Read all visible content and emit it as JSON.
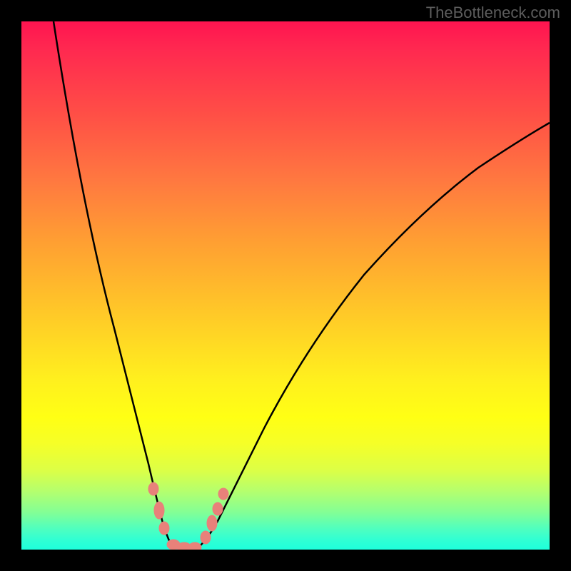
{
  "watermark": "TheBottleneck.com",
  "chart_data": {
    "type": "line",
    "title": "",
    "xlabel": "",
    "ylabel": "",
    "ylim": [
      0,
      100
    ],
    "xlim": [
      0,
      100
    ],
    "background_gradient": {
      "type": "vertical",
      "colors": [
        "#ff1450",
        "#ffa032",
        "#ffff14",
        "#32ffd2"
      ],
      "meaning": "bottleneck severity (red=high, green=low)"
    },
    "series": [
      {
        "name": "left-curve",
        "description": "descending curve from top-left to minimum",
        "x": [
          6,
          10,
          14,
          18,
          22,
          24,
          26,
          27,
          28
        ],
        "y": [
          100,
          80,
          58,
          38,
          20,
          12,
          6,
          3,
          0
        ]
      },
      {
        "name": "right-curve",
        "description": "ascending curve from minimum to top-right",
        "x": [
          33,
          35,
          38,
          42,
          48,
          56,
          66,
          78,
          92,
          100
        ],
        "y": [
          0,
          3,
          8,
          16,
          27,
          40,
          52,
          63,
          73,
          78
        ]
      },
      {
        "name": "flat-minimum",
        "description": "optimal zone at bottom",
        "x": [
          28,
          29,
          30,
          31,
          32,
          33
        ],
        "y": [
          0,
          0,
          0,
          0,
          0,
          0
        ]
      }
    ],
    "markers": {
      "description": "salmon colored data points near minimum",
      "color": "#e8817a",
      "points": [
        {
          "x": 25,
          "y": 11
        },
        {
          "x": 26.5,
          "y": 6
        },
        {
          "x": 28,
          "y": 1.5
        },
        {
          "x": 29.5,
          "y": 0.5
        },
        {
          "x": 31,
          "y": 0.5
        },
        {
          "x": 32.5,
          "y": 0.5
        },
        {
          "x": 34,
          "y": 2
        },
        {
          "x": 35.5,
          "y": 5
        },
        {
          "x": 37,
          "y": 8
        },
        {
          "x": 38,
          "y": 11
        }
      ]
    }
  }
}
